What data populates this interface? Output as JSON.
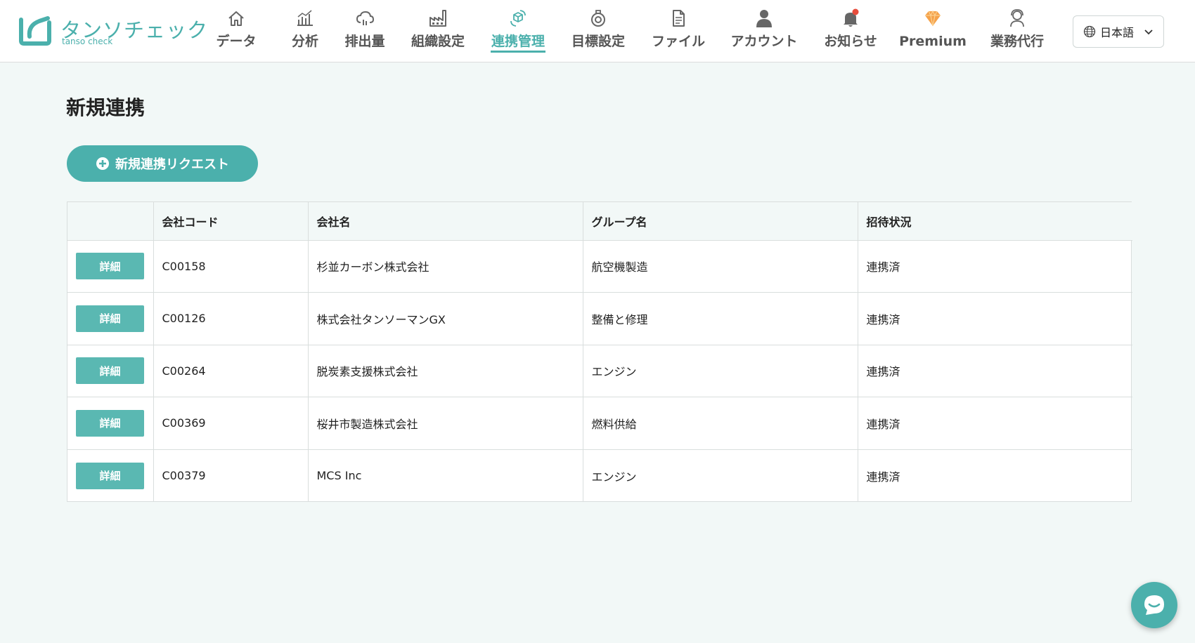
{
  "brand": {
    "name": "タンソチェック",
    "sub": "tanso check",
    "accent_color": "#4bb0ac"
  },
  "nav": {
    "items": [
      {
        "key": "data",
        "label": "データ",
        "icon": "home-icon"
      },
      {
        "key": "analysis",
        "label": "分析",
        "icon": "bar-chart-icon"
      },
      {
        "key": "emissions",
        "label": "排出量",
        "icon": "cloud-icon"
      },
      {
        "key": "org",
        "label": "組織設定",
        "icon": "factory-icon"
      },
      {
        "key": "link",
        "label": "連携管理",
        "icon": "link-cubes-icon",
        "active": true
      },
      {
        "key": "target",
        "label": "目標設定",
        "icon": "target-icon"
      },
      {
        "key": "file",
        "label": "ファイル",
        "icon": "file-icon"
      },
      {
        "key": "account",
        "label": "アカウント",
        "icon": "user-icon"
      },
      {
        "key": "notice",
        "label": "お知らせ",
        "icon": "bell-icon"
      },
      {
        "key": "premium",
        "label": "Premium",
        "icon": "diamond-icon"
      },
      {
        "key": "agency",
        "label": "業務代行",
        "icon": "support-agent-icon"
      }
    ],
    "language": {
      "label": "日本語",
      "icon": "globe-icon"
    }
  },
  "page": {
    "title": "新規連携",
    "new_request_label": "新規連携リクエスト"
  },
  "table": {
    "headers": {
      "action": "",
      "company_code": "会社コード",
      "company_name": "会社名",
      "group_name": "グループ名",
      "invite_status": "招待状況"
    },
    "detail_label": "詳細",
    "rows": [
      {
        "company_code": "C00158",
        "company_name": "杉並カーボン株式会社",
        "group_name": "航空機製造",
        "invite_status": "連携済"
      },
      {
        "company_code": "C00126",
        "company_name": "株式会社タンソーマンGX",
        "group_name": "整備と修理",
        "invite_status": "連携済"
      },
      {
        "company_code": "C00264",
        "company_name": "脱炭素支援株式会社",
        "group_name": "エンジン",
        "invite_status": "連携済"
      },
      {
        "company_code": "C00369",
        "company_name": "桜井市製造株式会社",
        "group_name": "燃料供給",
        "invite_status": "連携済"
      },
      {
        "company_code": "C00379",
        "company_name": "MCS Inc",
        "group_name": "エンジン",
        "invite_status": "連携済"
      }
    ]
  },
  "chat": {
    "icon": "chat-icon"
  }
}
